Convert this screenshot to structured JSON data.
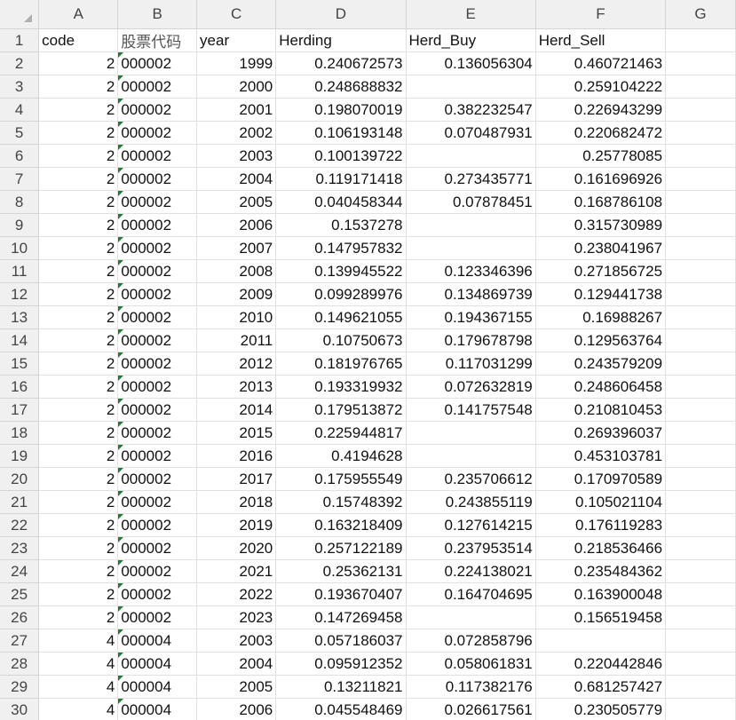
{
  "columns": [
    "A",
    "B",
    "C",
    "D",
    "E",
    "F",
    "G"
  ],
  "header": [
    "code",
    "股票代码",
    "year",
    "Herding",
    "Herd_Buy",
    "Herd_Sell",
    ""
  ],
  "rows": [
    [
      "2",
      "000002",
      "1999",
      "0.240672573",
      "0.136056304",
      "0.460721463"
    ],
    [
      "2",
      "000002",
      "2000",
      "0.248688832",
      "",
      "0.259104222"
    ],
    [
      "2",
      "000002",
      "2001",
      "0.198070019",
      "0.382232547",
      "0.226943299"
    ],
    [
      "2",
      "000002",
      "2002",
      "0.106193148",
      "0.070487931",
      "0.220682472"
    ],
    [
      "2",
      "000002",
      "2003",
      "0.100139722",
      "",
      "0.25778085"
    ],
    [
      "2",
      "000002",
      "2004",
      "0.119171418",
      "0.273435771",
      "0.161696926"
    ],
    [
      "2",
      "000002",
      "2005",
      "0.040458344",
      "0.07878451",
      "0.168786108"
    ],
    [
      "2",
      "000002",
      "2006",
      "0.1537278",
      "",
      "0.315730989"
    ],
    [
      "2",
      "000002",
      "2007",
      "0.147957832",
      "",
      "0.238041967"
    ],
    [
      "2",
      "000002",
      "2008",
      "0.139945522",
      "0.123346396",
      "0.271856725"
    ],
    [
      "2",
      "000002",
      "2009",
      "0.099289976",
      "0.134869739",
      "0.129441738"
    ],
    [
      "2",
      "000002",
      "2010",
      "0.149621055",
      "0.194367155",
      "0.16988267"
    ],
    [
      "2",
      "000002",
      "2011",
      "0.10750673",
      "0.179678798",
      "0.129563764"
    ],
    [
      "2",
      "000002",
      "2012",
      "0.181976765",
      "0.117031299",
      "0.243579209"
    ],
    [
      "2",
      "000002",
      "2013",
      "0.193319932",
      "0.072632819",
      "0.248606458"
    ],
    [
      "2",
      "000002",
      "2014",
      "0.179513872",
      "0.141757548",
      "0.210810453"
    ],
    [
      "2",
      "000002",
      "2015",
      "0.225944817",
      "",
      "0.269396037"
    ],
    [
      "2",
      "000002",
      "2016",
      "0.4194628",
      "",
      "0.453103781"
    ],
    [
      "2",
      "000002",
      "2017",
      "0.175955549",
      "0.235706612",
      "0.170970589"
    ],
    [
      "2",
      "000002",
      "2018",
      "0.15748392",
      "0.243855119",
      "0.105021104"
    ],
    [
      "2",
      "000002",
      "2019",
      "0.163218409",
      "0.127614215",
      "0.176119283"
    ],
    [
      "2",
      "000002",
      "2020",
      "0.257122189",
      "0.237953514",
      "0.218536466"
    ],
    [
      "2",
      "000002",
      "2021",
      "0.25362131",
      "0.224138021",
      "0.235484362"
    ],
    [
      "2",
      "000002",
      "2022",
      "0.193670407",
      "0.164704695",
      "0.163900048"
    ],
    [
      "2",
      "000002",
      "2023",
      "0.147269458",
      "",
      "0.156519458"
    ],
    [
      "4",
      "000004",
      "2003",
      "0.057186037",
      "0.072858796",
      ""
    ],
    [
      "4",
      "000004",
      "2004",
      "0.095912352",
      "0.058061831",
      "0.220442846"
    ],
    [
      "4",
      "000004",
      "2005",
      "0.13211821",
      "0.117382176",
      "0.681257427"
    ],
    [
      "4",
      "000004",
      "2006",
      "0.045548469",
      "0.026617561",
      "0.230505779"
    ]
  ]
}
